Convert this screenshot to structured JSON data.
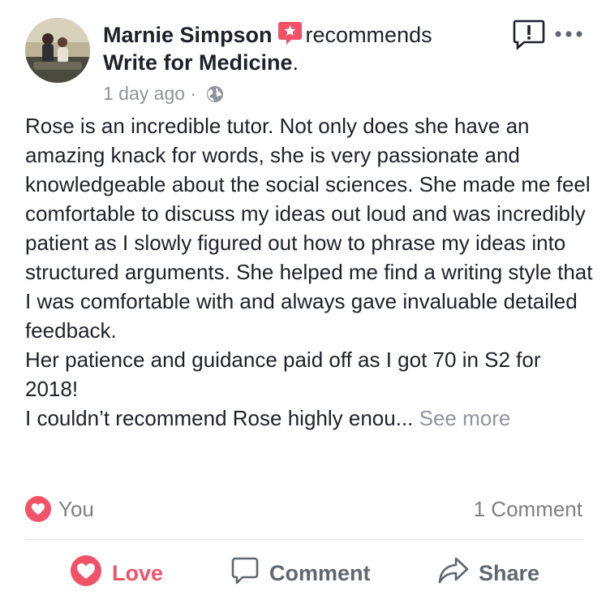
{
  "post": {
    "author": "Marnie Simpson",
    "action_text": "recommends",
    "page_name": "Write for Medicine",
    "page_suffix": ".",
    "timestamp": "1 day ago",
    "separator": "·",
    "privacy_icon": "globe-icon",
    "badge_icon": "recommendation-star-icon",
    "paragraphs": [
      "Rose is an incredible tutor. Not only does she have an amazing knack for words, she is very passionate and knowledgeable about the social sciences. She made me feel comfortable to discuss my ideas out loud and was incredibly patient as I slowly figured out how to phrase my ideas into structured arguments. She helped me find a writing style that I was comfortable with and always gave invaluable detailed feedback.",
      "Her patience and guidance paid off as I got 70 in S2 for 2018!"
    ],
    "truncated_line": "I couldn’t recommend Rose highly enou...",
    "see_more": "See more"
  },
  "reactions": {
    "icon": "love-reaction-icon",
    "reactor": "You",
    "comment_count": "1 Comment"
  },
  "actions": {
    "love": "Love",
    "comment": "Comment",
    "share": "Share"
  },
  "colors": {
    "love": "#f25268",
    "muted": "#90949c",
    "text": "#1d2129",
    "divider": "#dddfe2"
  }
}
